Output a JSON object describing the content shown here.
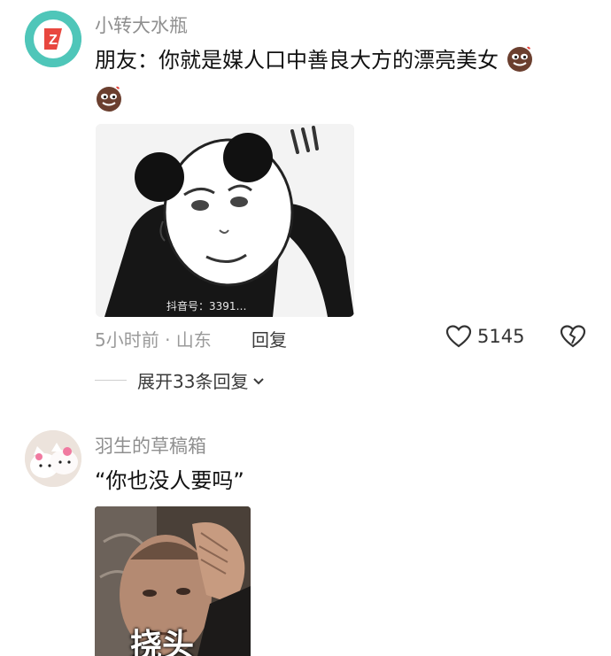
{
  "comments": [
    {
      "user": "小转大水瓶",
      "text_line1": "朋友：你就是媒人口中善良大方的漂亮美女",
      "sticker_watermark": "抖音号：3391…",
      "time_location": "5小时前 · 山东",
      "reply_label": "回复",
      "like_count": "5145",
      "expand_label": "展开33条回复",
      "avatar_badge": "Z"
    },
    {
      "user": "羽生的草稿箱",
      "text_line1": "“你也没人要吗”",
      "sticker_caption": "挠头"
    }
  ],
  "colors": {
    "avatar1_bg": "#4fc6b9",
    "accent_red": "#e8473f",
    "meta_gray": "#9a9a9a"
  },
  "icons": {
    "like": "heart-outline-icon",
    "dislike": "broken-heart-icon",
    "expand": "chevron-down-icon",
    "emoji": "brown-face-emoji-icon"
  }
}
